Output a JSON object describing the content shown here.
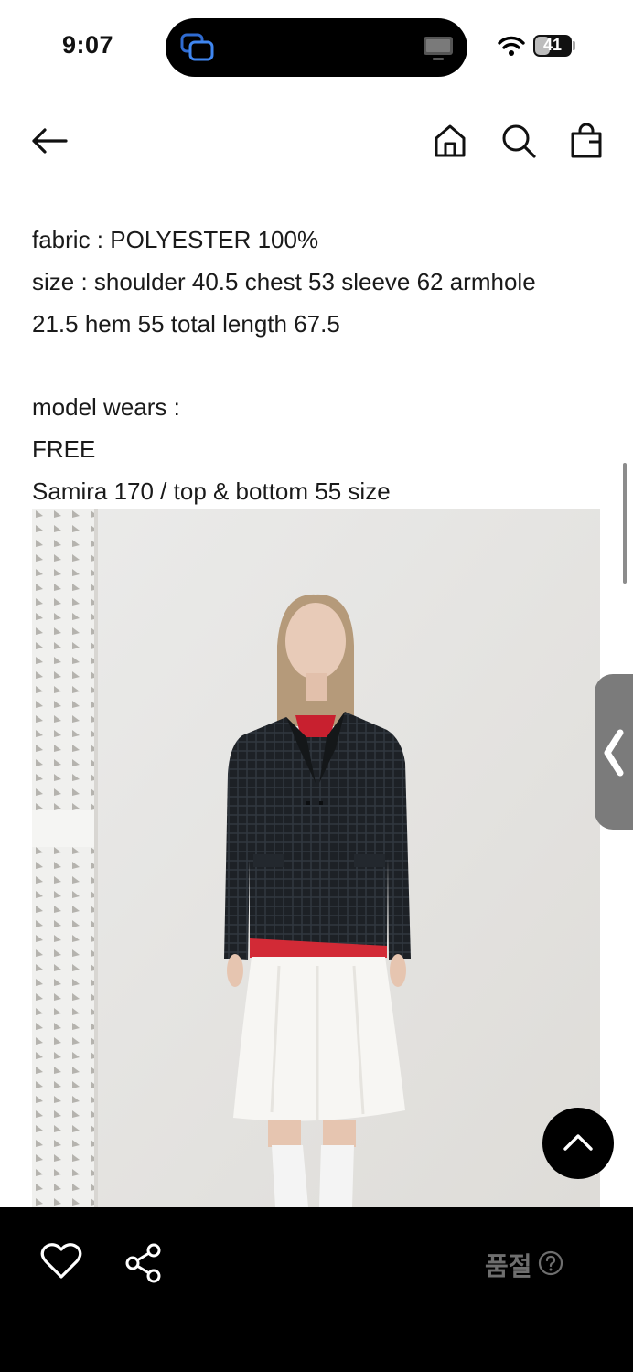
{
  "status_bar": {
    "time": "9:07",
    "battery_level": "41",
    "icons": [
      "island-app-icon",
      "screen-mirror-icon",
      "wifi-icon",
      "battery-icon"
    ]
  },
  "header": {
    "icons": [
      "back-arrow-icon",
      "home-icon",
      "search-icon",
      "shopping-bag-icon"
    ]
  },
  "description": {
    "fabric": "fabric : POLYESTER 100%",
    "size_line1": "size : shoulder 40.5 chest 53 sleeve 62 armhole",
    "size_line2": "21.5 hem 55 total length 67.5",
    "model_heading": "model wears :",
    "model_size": "FREE",
    "model_info": "Samira 170 / top & bottom 55 size"
  },
  "photo": {
    "subject": "model in dark checked blazer, red top and white skirt"
  },
  "floating": {
    "icons": [
      "side-handle-chevron-icon",
      "scroll-top-chevron-icon"
    ]
  },
  "bottom_bar": {
    "status_label": "품절",
    "icons": [
      "heart-icon",
      "share-icon",
      "help-circle-icon"
    ]
  },
  "colors": {
    "background": "#ffffff",
    "bottom_bar": "#000000",
    "soldout_text": "#6e6e6e"
  }
}
